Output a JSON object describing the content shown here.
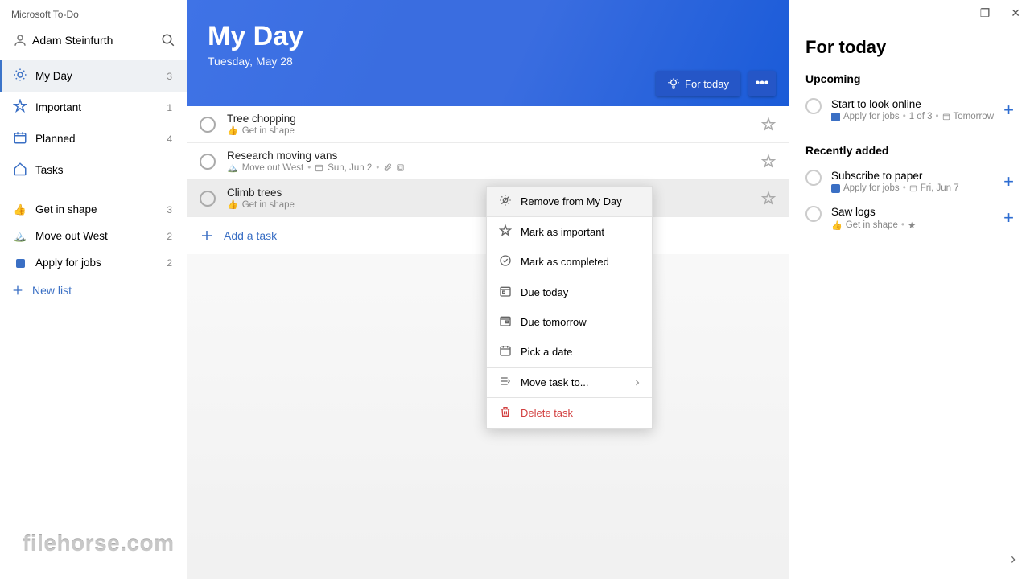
{
  "app": {
    "title": "Microsoft To-Do",
    "user": "Adam Steinfurth"
  },
  "nav": {
    "myday": {
      "label": "My Day",
      "count": "3"
    },
    "important": {
      "label": "Important",
      "count": "1"
    },
    "planned": {
      "label": "Planned",
      "count": "4"
    },
    "tasks": {
      "label": "Tasks",
      "count": ""
    }
  },
  "lists": [
    {
      "emoji": "👍",
      "label": "Get in shape",
      "count": "3"
    },
    {
      "emoji": "🏔️",
      "label": "Move out West",
      "count": "2"
    },
    {
      "emoji": "🔵",
      "label": "Apply for jobs",
      "count": "2"
    }
  ],
  "newList": "New list",
  "hero": {
    "title": "My Day",
    "date": "Tuesday, May 28",
    "forToday": "For today"
  },
  "tasks": [
    {
      "title": "Tree chopping",
      "listEmoji": "👍",
      "listName": "Get in shape",
      "extra": ""
    },
    {
      "title": "Research moving vans",
      "listEmoji": "🏔️",
      "listName": "Move out West",
      "due": "Sun, Jun 2",
      "attach": true,
      "steps": true
    },
    {
      "title": "Climb trees",
      "listEmoji": "👍",
      "listName": "Get in shape",
      "extra": ""
    }
  ],
  "addTask": "Add a task",
  "ctx": {
    "remove": "Remove from My Day",
    "important": "Mark as important",
    "completed": "Mark as completed",
    "today": "Due today",
    "tomorrow": "Due tomorrow",
    "pick": "Pick a date",
    "move": "Move task to...",
    "delete": "Delete task"
  },
  "right": {
    "title": "For today",
    "upcoming": "Upcoming",
    "recent": "Recently added",
    "sug": [
      {
        "title": "Start to look online",
        "listName": "Apply for jobs",
        "meta": "1 of 3",
        "due": "Tomorrow"
      },
      {
        "title": "Subscribe to paper",
        "listName": "Apply for jobs",
        "due": "Fri, Jun 7"
      },
      {
        "title": "Saw logs",
        "listEmoji": "👍",
        "listName": "Get in shape",
        "starred": true
      }
    ]
  },
  "watermark": "filehorse.com"
}
